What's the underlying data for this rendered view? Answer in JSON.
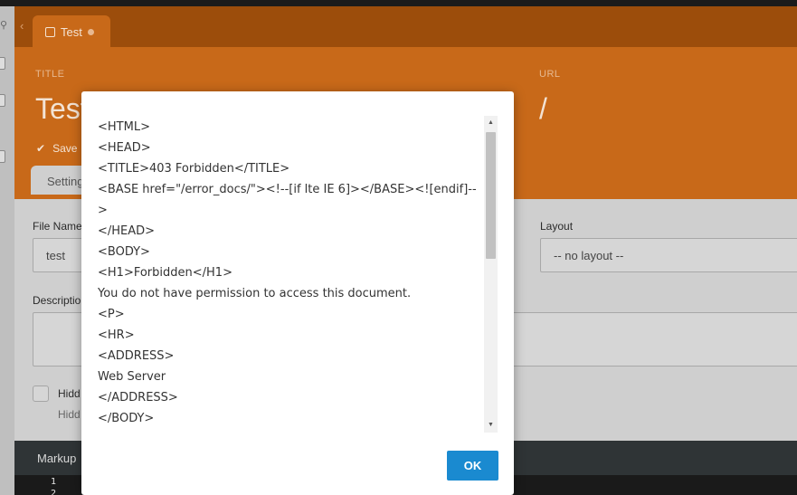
{
  "tab": {
    "title": "Test"
  },
  "header": {
    "title_label": "TITLE",
    "title_value": "Test",
    "url_label": "URL",
    "url_value": "/",
    "saved_text": "Save",
    "settings_tab": "Setting"
  },
  "form": {
    "file_name_label": "File Name",
    "file_name_value": "test",
    "layout_label": "Layout",
    "layout_value": "-- no layout --",
    "description_label": "Descriptio",
    "hidden_label": "Hidd",
    "hidden_hint": "Hidd"
  },
  "markup": {
    "label": "Markup",
    "line_numbers": [
      "1",
      "2"
    ]
  },
  "modal": {
    "lines": [
      "<HTML>",
      "<HEAD>",
      "<TITLE>403 Forbidden</TITLE>",
      "<BASE href=\"/error_docs/\"><!--[if lte IE 6]></BASE><![endif]--",
      ">",
      "</HEAD>",
      "<BODY>",
      "<H1>Forbidden</H1>",
      "You do not have permission to access this document.",
      "<P>",
      "<HR>",
      "<ADDRESS>",
      "Web Server",
      "</ADDRESS>",
      "</BODY>"
    ],
    "ok_label": "OK"
  },
  "colors": {
    "accent": "#c86919",
    "ok_button": "#1a8ad0"
  }
}
